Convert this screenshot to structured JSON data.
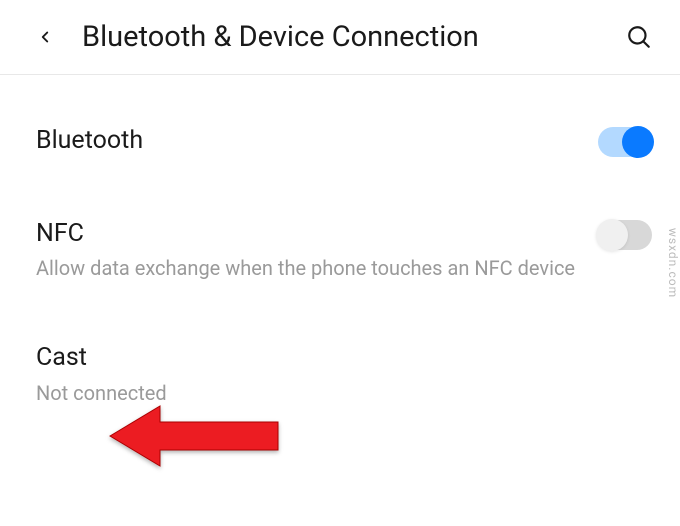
{
  "header": {
    "title": "Bluetooth & Device Connection"
  },
  "settings": {
    "bluetooth": {
      "label": "Bluetooth",
      "enabled": true
    },
    "nfc": {
      "label": "NFC",
      "description": "Allow data exchange when the phone touches an NFC device",
      "enabled": false
    },
    "cast": {
      "label": "Cast",
      "status": "Not connected"
    }
  },
  "watermark": "wsxdn.com"
}
